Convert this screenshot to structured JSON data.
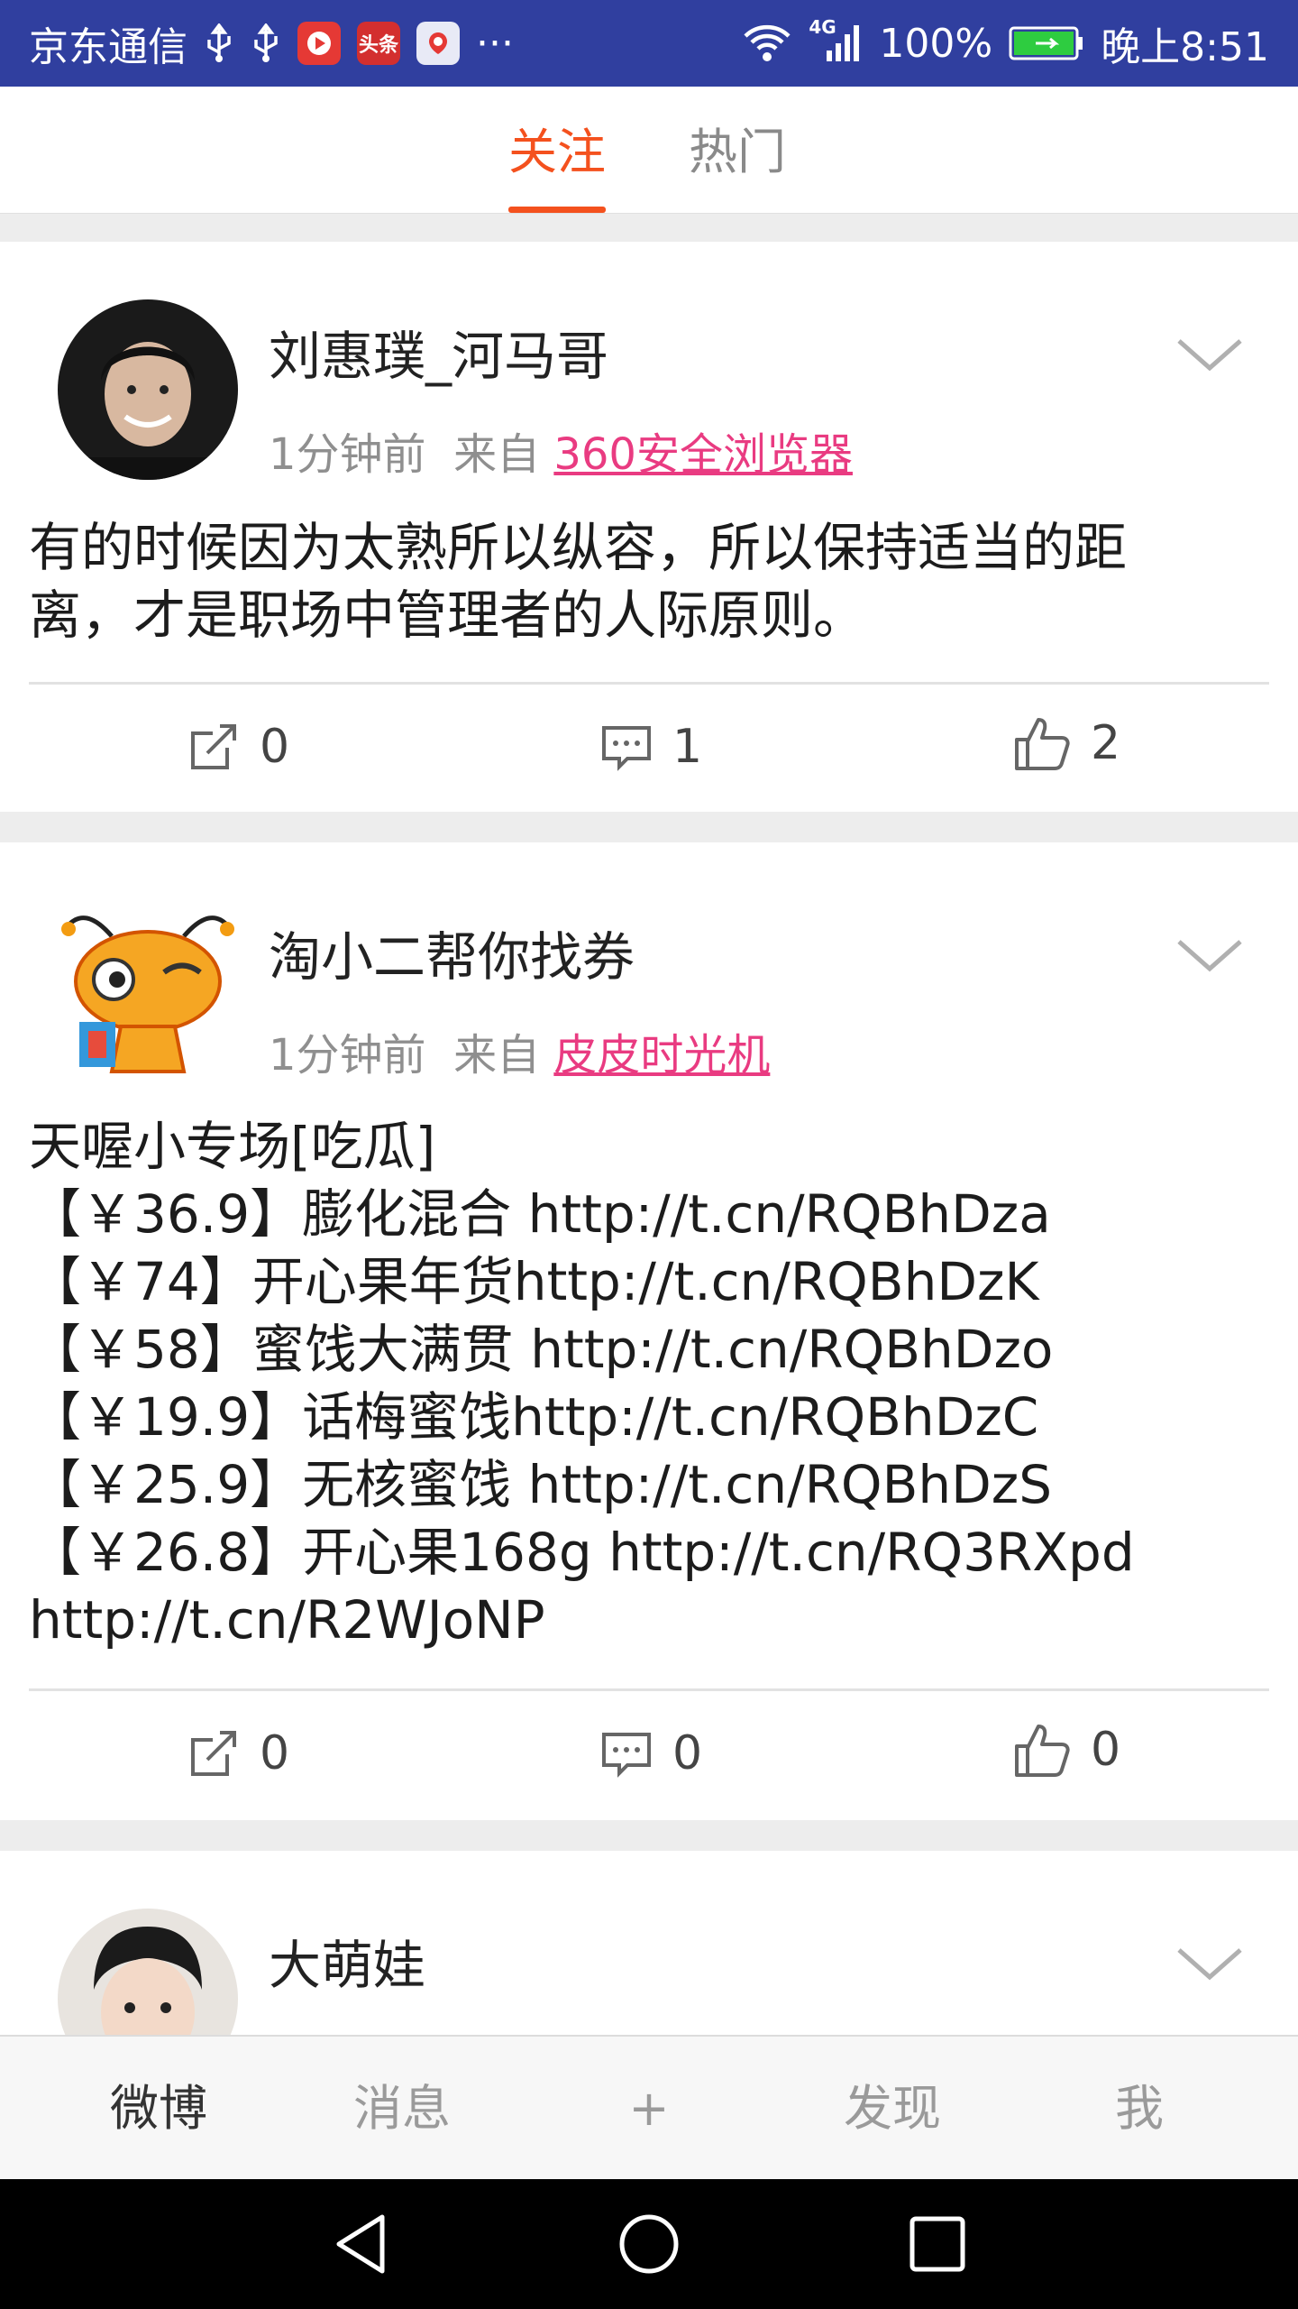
{
  "status_bar": {
    "carrier": "京东通信",
    "badge_toutiao": "头条",
    "dots": "···",
    "network": "4G",
    "battery": "100%",
    "time": "晚上8:51"
  },
  "tabs": [
    {
      "label": "关注",
      "active": true
    },
    {
      "label": "热门",
      "active": false
    }
  ],
  "posts": [
    {
      "username": "刘惠璞_河马哥",
      "time": "1分钟前",
      "from_label": "来自",
      "source": "360安全浏览器",
      "text_lines": [
        "有的时候因为太熟所以纵容，所以保持适当的距",
        "离，才是职场中管理者的人际原则。"
      ],
      "reposts": "0",
      "comments": "1",
      "likes": "2"
    },
    {
      "username": "淘小二帮你找券",
      "time": "1分钟前",
      "from_label": "来自",
      "source": "皮皮时光机",
      "text_lines": [
        "天喔小专场[吃瓜]",
        "【￥36.9】膨化混合 http://t.cn/RQBhDza",
        "【￥74】开心果年货http://t.cn/RQBhDzK",
        "【￥58】蜜饯大满贯 http://t.cn/RQBhDzo",
        "【￥19.9】话梅蜜饯http://t.cn/RQBhDzC",
        "【￥25.9】无核蜜饯 http://t.cn/RQBhDzS",
        "【￥26.8】开心果168g http://t.cn/RQ3RXpd",
        "http://t.cn/R2WJoNP"
      ],
      "reposts": "0",
      "comments": "0",
      "likes": "0"
    },
    {
      "username": "大萌娃"
    }
  ],
  "bottom_nav": [
    {
      "label": "微博",
      "active": true
    },
    {
      "label": "消息",
      "active": false
    },
    {
      "label": "+",
      "active": false
    },
    {
      "label": "发现",
      "active": false
    },
    {
      "label": "我",
      "active": false
    }
  ],
  "colors": {
    "status_bar": "#303f9f",
    "accent": "#f4511e",
    "source_link": "#e93b81"
  }
}
